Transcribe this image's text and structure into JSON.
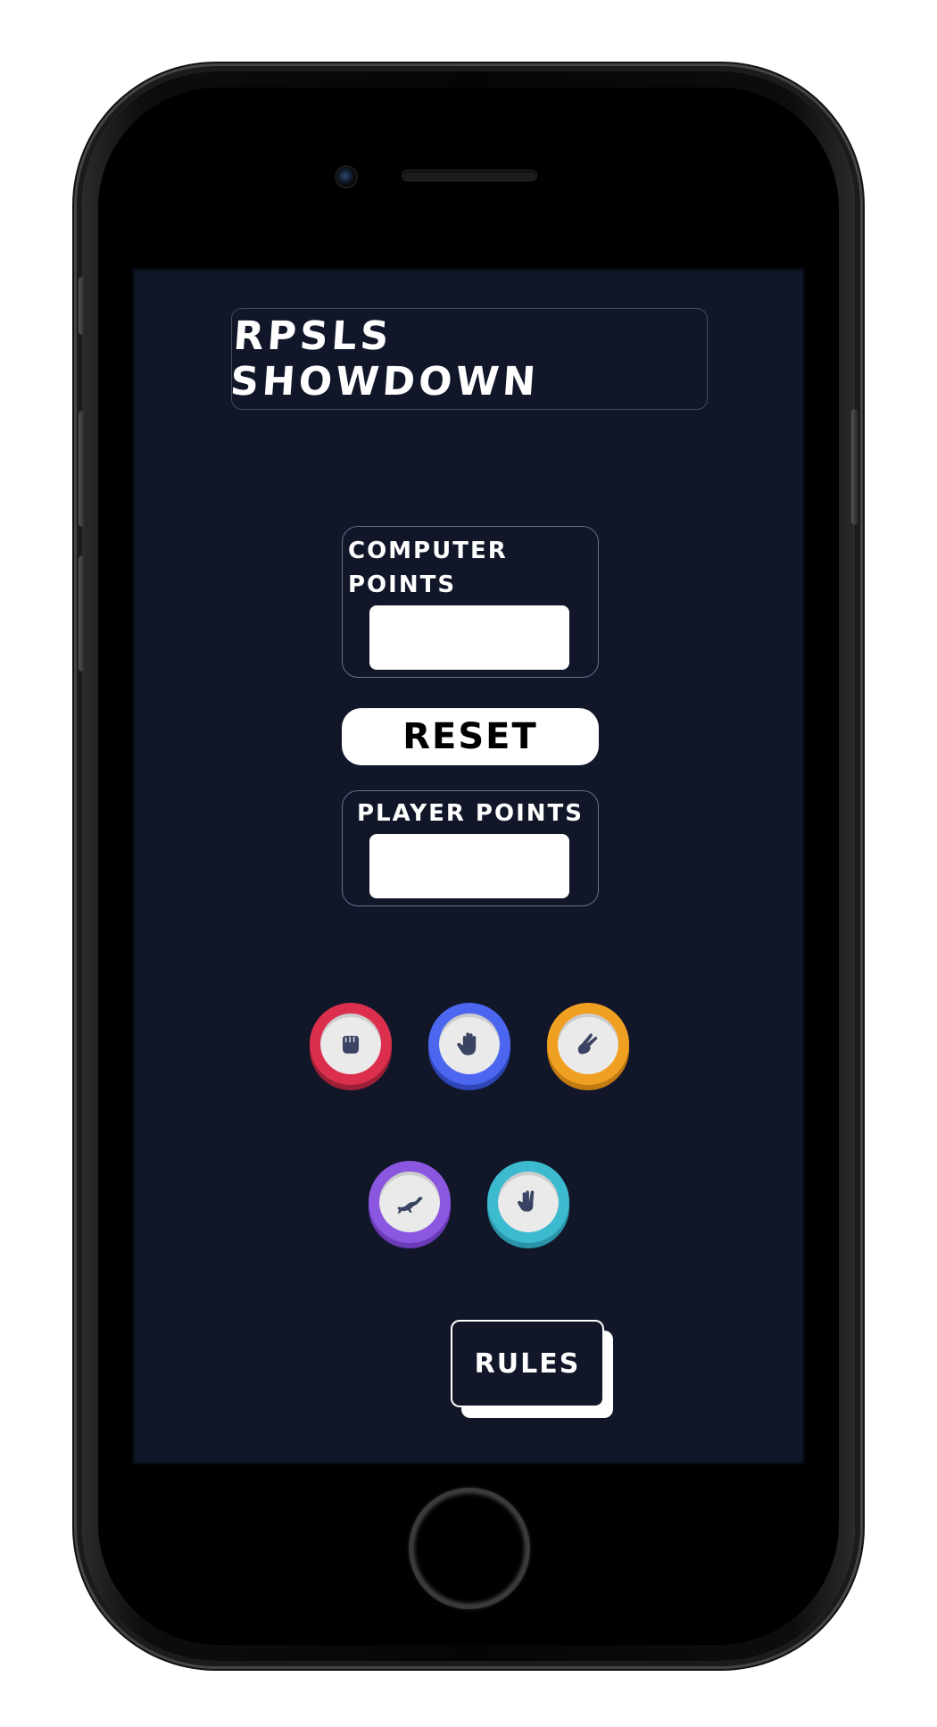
{
  "app": {
    "title": "RPSLS SHOWDOWN"
  },
  "scores": {
    "computer_label": "COMPUTER POINTS",
    "computer_value": "",
    "player_label": "PLAYER POINTS",
    "player_value": ""
  },
  "controls": {
    "reset_label": "RESET",
    "rules_label": "RULES"
  },
  "choices": [
    {
      "name": "rock",
      "icon": "fist-icon",
      "color": "#dc2f4d",
      "shadow": "#9b1f36"
    },
    {
      "name": "paper",
      "icon": "open-hand-icon",
      "color": "#4c66f0",
      "shadow": "#2e45b8"
    },
    {
      "name": "scissors",
      "icon": "scissors-hand-icon",
      "color": "#f0a021",
      "shadow": "#c27a12"
    },
    {
      "name": "lizard",
      "icon": "lizard-icon",
      "color": "#8b57e0",
      "shadow": "#6a3bb8"
    },
    {
      "name": "spock",
      "icon": "spock-hand-icon",
      "color": "#3cbad0",
      "shadow": "#2a93a8"
    }
  ],
  "colors": {
    "background": "#111729",
    "text": "#ffffff",
    "icon": "#3b4363"
  }
}
